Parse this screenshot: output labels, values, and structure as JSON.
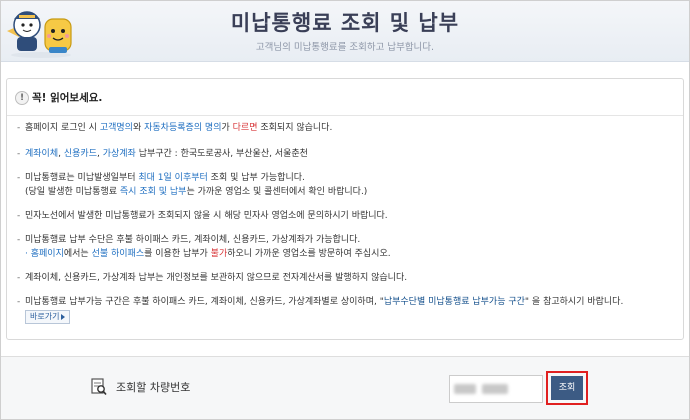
{
  "header": {
    "title": "미납통행료 조회 및 납부",
    "subtitle": "고객님의 미납통행료를 조회하고 납부합니다."
  },
  "notice": {
    "icon_name": "info-icon",
    "icon_glyph": "!",
    "title": "꼭! 읽어보세요.",
    "bullet": "-",
    "items": [
      {
        "p1": "홈페이지 로그인 시 ",
        "p2": "고객명의",
        "p3": "와 ",
        "p4": "자동차등록증의 명의",
        "p5": "가 ",
        "p6": "다르면",
        "p7": " 조회되지 않습니다."
      },
      {
        "p1": "계좌이체",
        "p2": ", ",
        "p3": "신용카드",
        "p4": ", ",
        "p5": "가상계좌",
        "p6": " 납부구간 : 한국도로공사, 부산울산, 서울춘천"
      },
      {
        "line1_p1": "미납통행료는 미납발생일부터 ",
        "line1_p2": "최대 1일 이후부터",
        "line1_p3": " 조회 및 납부 가능합니다.",
        "line2_p1": "(당일 발생한 미납통행료 ",
        "line2_p2": "즉시 조회 및 납부",
        "line2_p3": "는 가까운 영업소 및 콜센터에서 확인 바랍니다.)"
      },
      {
        "p1": "민자노선에서 발생한 미납통행료가 조회되지 않을 시 해당 민자사 영업소에 문의하시기 바랍니다."
      },
      {
        "line1": "미납통행료 납부 수단은 후불 하이패스 카드, 계좌이체, 신용카드, 가상계좌가 가능합니다.",
        "line2_dot": "·",
        "line2_p1": "홈페이지",
        "line2_p2": "에서는 ",
        "line2_p3": "선불 하이패스",
        "line2_p4": "를 이용한 납부가 ",
        "line2_p5": "불가",
        "line2_p6": "하오니 가까운 영업소를 방문하여 주십시오."
      },
      {
        "p1": "계좌이체, 신용카드, 가상계좌 납부는 개인정보를 보관하지 않으므로 전자계산서를 발행하지 않습니다."
      },
      {
        "p1": "미납통행료 납부가능 구간은 후불 하이패스 카드, 계좌이체, 신용카드, 가상계좌별로 상이하며, \"",
        "p2": "납부수단별 미납통행료 납부가능 구간",
        "p3": "\" 을 참고하시기 바랍니다.",
        "more_button": "바로가기"
      }
    ]
  },
  "search": {
    "icon_name": "vehicle-document-search-icon",
    "label": "조회할 차량번호",
    "button_label": "조회"
  },
  "colors": {
    "link_blue": "#1f6fc1",
    "warning_red": "#d8373a",
    "button_navy": "#3c5b84",
    "highlight_border": "#e02020"
  }
}
